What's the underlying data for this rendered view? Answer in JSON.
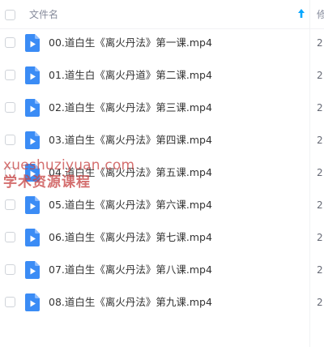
{
  "header": {
    "name_label": "文件名",
    "modified_label": "修",
    "sort_icon": "sort-ascending-arrow-icon"
  },
  "files": [
    {
      "name": "00.道白生《离火丹法》第一课.mp4",
      "modified": "2"
    },
    {
      "name": "01.道生白《离火丹道》第二课.mp4",
      "modified": "2"
    },
    {
      "name": "02.道白生《离火丹法》第三课.mp4",
      "modified": "2"
    },
    {
      "name": "03.道白生《离火丹法》第四课.mp4",
      "modified": "2"
    },
    {
      "name": "04.道白生《离火丹法》第五课.mp4",
      "modified": "2"
    },
    {
      "name": "05.道白生《离火丹法》第六课.mp4",
      "modified": "2"
    },
    {
      "name": "06.道白生《离火丹法》第七课.mp4",
      "modified": "2"
    },
    {
      "name": "07.道白生《离火丹法》第八课.mp4",
      "modified": "2"
    },
    {
      "name": "08.道白生《离火丹法》第九课.mp4",
      "modified": "2"
    }
  ],
  "file_icon": "video-file-icon",
  "watermark": {
    "line1": "xueshuziyuan.com",
    "line2": "学术资源课程"
  },
  "colors": {
    "accent": "#06a7ff",
    "file_icon": "#3b8cf5",
    "text": "#333333",
    "header_text": "#878c9c"
  }
}
